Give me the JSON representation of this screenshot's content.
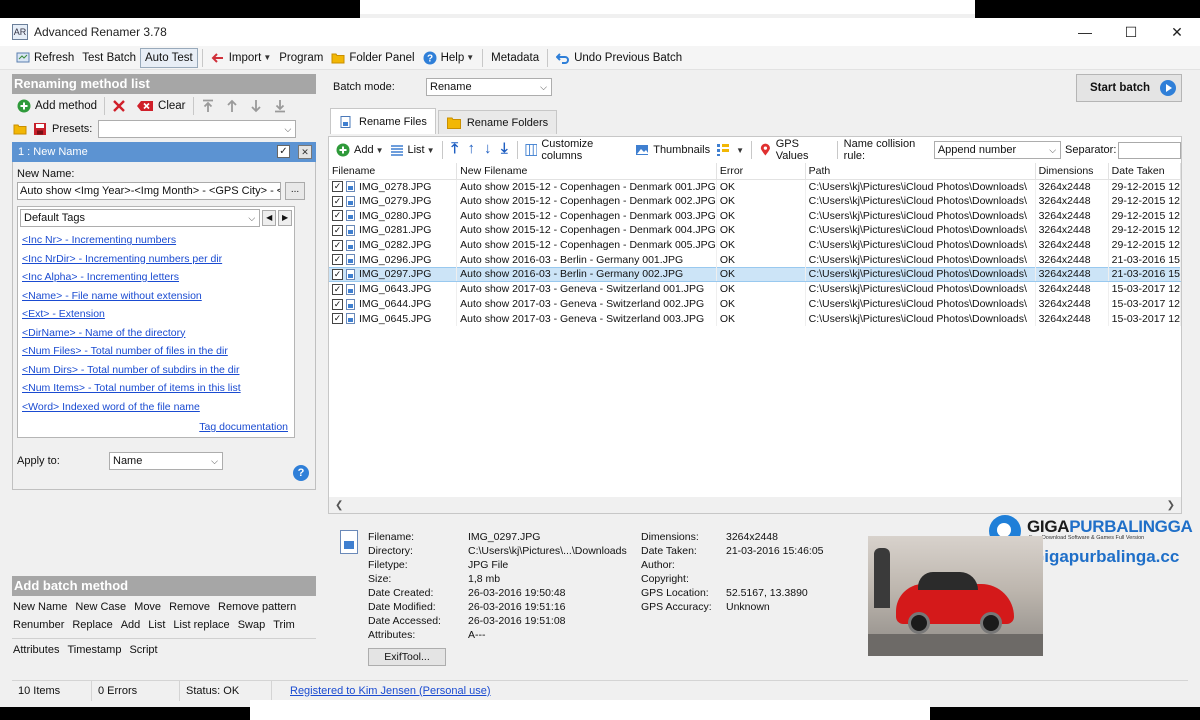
{
  "window": {
    "title": "Advanced Renamer 3.78",
    "icon_text": "AR",
    "minimize": "—",
    "maximize": "☐",
    "close": "✕"
  },
  "toolbar": {
    "refresh": "Refresh",
    "test_batch": "Test Batch",
    "auto_test": "Auto Test",
    "import": "Import",
    "program": "Program",
    "folder_panel": "Folder Panel",
    "help": "Help",
    "metadata": "Metadata",
    "undo": "Undo Previous Batch"
  },
  "left": {
    "header": "Renaming method list",
    "add_method": "Add method",
    "clear": "Clear",
    "presets_label": "Presets:",
    "method_title": "1 : New Name",
    "new_name_label": "New Name:",
    "new_name_value": "Auto show <Img Year>-<Img Month> - <GPS City> - <GPS",
    "dots": "...",
    "tags_select": "Default Tags",
    "tags": [
      "<Inc Nr> - Incrementing numbers",
      "<Inc NrDir> - Incrementing numbers per dir",
      "<Inc Alpha> - Incrementing letters",
      "<Name> - File name without extension",
      "<Ext> - Extension",
      "<DirName> - Name of the directory",
      "<Num Files> - Total number of files in the dir",
      "<Num Dirs> - Total number of subdirs in the dir",
      "<Num Items> - Total number of items in this list",
      "<Word> Indexed word of the file name"
    ],
    "tag_documentation": "Tag documentation",
    "apply_to_label": "Apply to:",
    "apply_to_value": "Name",
    "help": "?"
  },
  "batch_methods": {
    "header": "Add batch method",
    "row1": [
      "New Name",
      "New Case",
      "Move",
      "Remove",
      "Remove pattern"
    ],
    "row2": [
      "Renumber",
      "Replace",
      "Add",
      "List",
      "List replace",
      "Swap",
      "Trim"
    ],
    "row3": [
      "Attributes",
      "Timestamp",
      "Script"
    ]
  },
  "right": {
    "batch_mode_label": "Batch mode:",
    "batch_mode_value": "Rename",
    "start_batch": "Start batch",
    "tabs": [
      "Rename Files",
      "Rename Folders"
    ],
    "grid_toolbar": {
      "add": "Add",
      "list": "List",
      "customize": "Customize columns",
      "thumbnails": "Thumbnails",
      "gps": "GPS Values",
      "collision_label": "Name collision rule:",
      "collision_value": "Append number",
      "separator_label": "Separator:"
    },
    "columns": [
      "Filename",
      "New Filename",
      "Error",
      "Path",
      "Dimensions",
      "Date Taken"
    ],
    "rows": [
      [
        "IMG_0278.JPG",
        "Auto show 2015-12 - Copenhagen - Denmark 001.JPG",
        "OK",
        "C:\\Users\\kj\\Pictures\\iCloud Photos\\Downloads\\",
        "3264x2448",
        "29-12-2015 12"
      ],
      [
        "IMG_0279.JPG",
        "Auto show 2015-12 - Copenhagen - Denmark 002.JPG",
        "OK",
        "C:\\Users\\kj\\Pictures\\iCloud Photos\\Downloads\\",
        "3264x2448",
        "29-12-2015 12"
      ],
      [
        "IMG_0280.JPG",
        "Auto show 2015-12 - Copenhagen - Denmark 003.JPG",
        "OK",
        "C:\\Users\\kj\\Pictures\\iCloud Photos\\Downloads\\",
        "3264x2448",
        "29-12-2015 12"
      ],
      [
        "IMG_0281.JPG",
        "Auto show 2015-12 - Copenhagen - Denmark 004.JPG",
        "OK",
        "C:\\Users\\kj\\Pictures\\iCloud Photos\\Downloads\\",
        "3264x2448",
        "29-12-2015 12"
      ],
      [
        "IMG_0282.JPG",
        "Auto show 2015-12 - Copenhagen - Denmark 005.JPG",
        "OK",
        "C:\\Users\\kj\\Pictures\\iCloud Photos\\Downloads\\",
        "3264x2448",
        "29-12-2015 12"
      ],
      [
        "IMG_0296.JPG",
        "Auto show 2016-03 - Berlin - Germany 001.JPG",
        "OK",
        "C:\\Users\\kj\\Pictures\\iCloud Photos\\Downloads\\",
        "3264x2448",
        "21-03-2016 15"
      ],
      [
        "IMG_0297.JPG",
        "Auto show 2016-03 - Berlin - Germany 002.JPG",
        "OK",
        "C:\\Users\\kj\\Pictures\\iCloud Photos\\Downloads\\",
        "3264x2448",
        "21-03-2016 15"
      ],
      [
        "IMG_0643.JPG",
        "Auto show 2017-03 - Geneva - Switzerland 001.JPG",
        "OK",
        "C:\\Users\\kj\\Pictures\\iCloud Photos\\Downloads\\",
        "3264x2448",
        "15-03-2017 12"
      ],
      [
        "IMG_0644.JPG",
        "Auto show 2017-03 - Geneva - Switzerland 002.JPG",
        "OK",
        "C:\\Users\\kj\\Pictures\\iCloud Photos\\Downloads\\",
        "3264x2448",
        "15-03-2017 12"
      ],
      [
        "IMG_0645.JPG",
        "Auto show 2017-03 - Geneva - Switzerland 003.JPG",
        "OK",
        "C:\\Users\\kj\\Pictures\\iCloud Photos\\Downloads\\",
        "3264x2448",
        "15-03-2017 12"
      ]
    ],
    "selected_row": 6
  },
  "info": {
    "col1": [
      [
        "Filename:",
        "IMG_0297.JPG"
      ],
      [
        "Directory:",
        "C:\\Users\\kj\\Pictures\\...\\Downloads"
      ],
      [
        "Filetype:",
        "JPG File"
      ],
      [
        "Size:",
        "1,8 mb"
      ],
      [
        "Date Created:",
        "26-03-2016 19:50:48"
      ],
      [
        "Date Modified:",
        "26-03-2016 19:51:16"
      ],
      [
        "Date Accessed:",
        "26-03-2016 19:51:08"
      ],
      [
        "Attributes:",
        "A---"
      ]
    ],
    "col2": [
      [
        "Dimensions:",
        "3264x2448"
      ],
      [
        "Date Taken:",
        "21-03-2016 15:46:05"
      ],
      [
        "Author:",
        ""
      ],
      [
        "Copyright:",
        ""
      ],
      [
        "GPS Location:",
        "52.5167, 13.3890"
      ],
      [
        "GPS Accuracy:",
        "Unknown"
      ]
    ],
    "exif_button": "ExifTool..."
  },
  "watermark": {
    "brand_a": "GIGA",
    "brand_b": "PURBALINGGA",
    "tagline": "Free Download Software & Games Full Version",
    "url": "Gigapurbalinga.cc"
  },
  "status": {
    "items": "10 Items",
    "errors": "0 Errors",
    "status": "Status: OK",
    "registered": "Registered to Kim Jensen (Personal use)"
  }
}
